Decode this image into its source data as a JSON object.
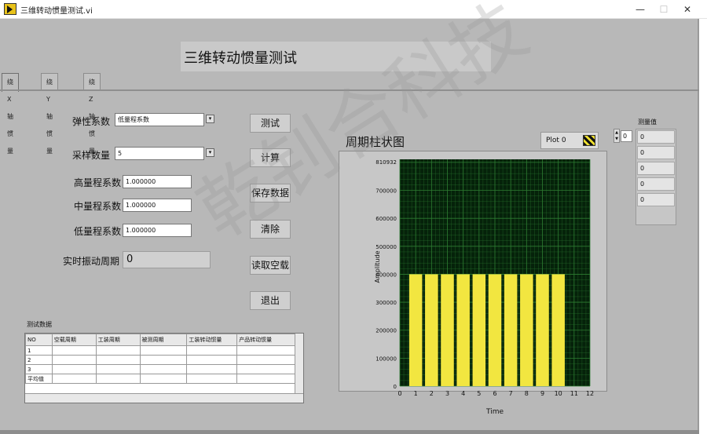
{
  "window": {
    "title": "三维转动惯量测试.vi",
    "controls": [
      "—",
      "☐",
      "✕"
    ]
  },
  "panel": {
    "title": "三维转动惯量测试"
  },
  "tabs": [
    "绕X轴惯量",
    "绕Y轴惯量",
    "绕Z轴惯量"
  ],
  "form": {
    "elasticity": {
      "label": "弹性系数",
      "value": "低量程系数"
    },
    "samples": {
      "label": "采样数量",
      "value": "5"
    },
    "high_coef": {
      "label": "高量程系数",
      "value": "1.000000"
    },
    "mid_coef": {
      "label": "中量程系数",
      "value": "1.000000"
    },
    "low_coef": {
      "label": "低量程系数",
      "value": "1.000000"
    },
    "period": {
      "label": "实时振动周期",
      "value": "0"
    }
  },
  "buttons": [
    "测试",
    "计算",
    "保存数据",
    "清除",
    "读取空载",
    "退出"
  ],
  "table": {
    "label": "测试数据",
    "headers": [
      "NO",
      "空载周期",
      "工装周期",
      "被测周期",
      "工装转动惯量",
      "产品转动惯量"
    ],
    "rows": [
      "1",
      "2",
      "3",
      "平均值"
    ]
  },
  "chart": {
    "title": "周期柱状图",
    "legend": "Plot 0",
    "ylabel": "Amplitude",
    "xlabel": "Time"
  },
  "chart_data": {
    "type": "bar",
    "title": "周期柱状图",
    "xlabel": "Time",
    "ylabel": "Amplitude",
    "x": [
      1,
      2,
      3,
      4,
      5,
      6,
      7,
      8,
      9,
      10
    ],
    "values": [
      400000,
      400000,
      400000,
      400000,
      400000,
      400000,
      400000,
      400000,
      400000,
      400000
    ],
    "xlim": [
      0,
      12
    ],
    "ylim": [
      0,
      810932
    ],
    "y_ticks": [
      0,
      100000,
      200000,
      300000,
      400000,
      500000,
      600000,
      700000
    ],
    "y_top_label": "810932",
    "x_ticks": [
      "0",
      "1",
      "2",
      "3",
      "4",
      "5",
      "6",
      "7",
      "8",
      "9",
      "10",
      "11",
      "12"
    ],
    "grid": true,
    "colors": {
      "bar": "#f2e640",
      "background": "#05220a",
      "grid": "#2e7d32"
    }
  },
  "spinner": {
    "value": "0"
  },
  "measurements": {
    "label": "测量值",
    "values": [
      "0",
      "0",
      "0",
      "0",
      "0"
    ]
  },
  "watermark": "乾钊合科技"
}
